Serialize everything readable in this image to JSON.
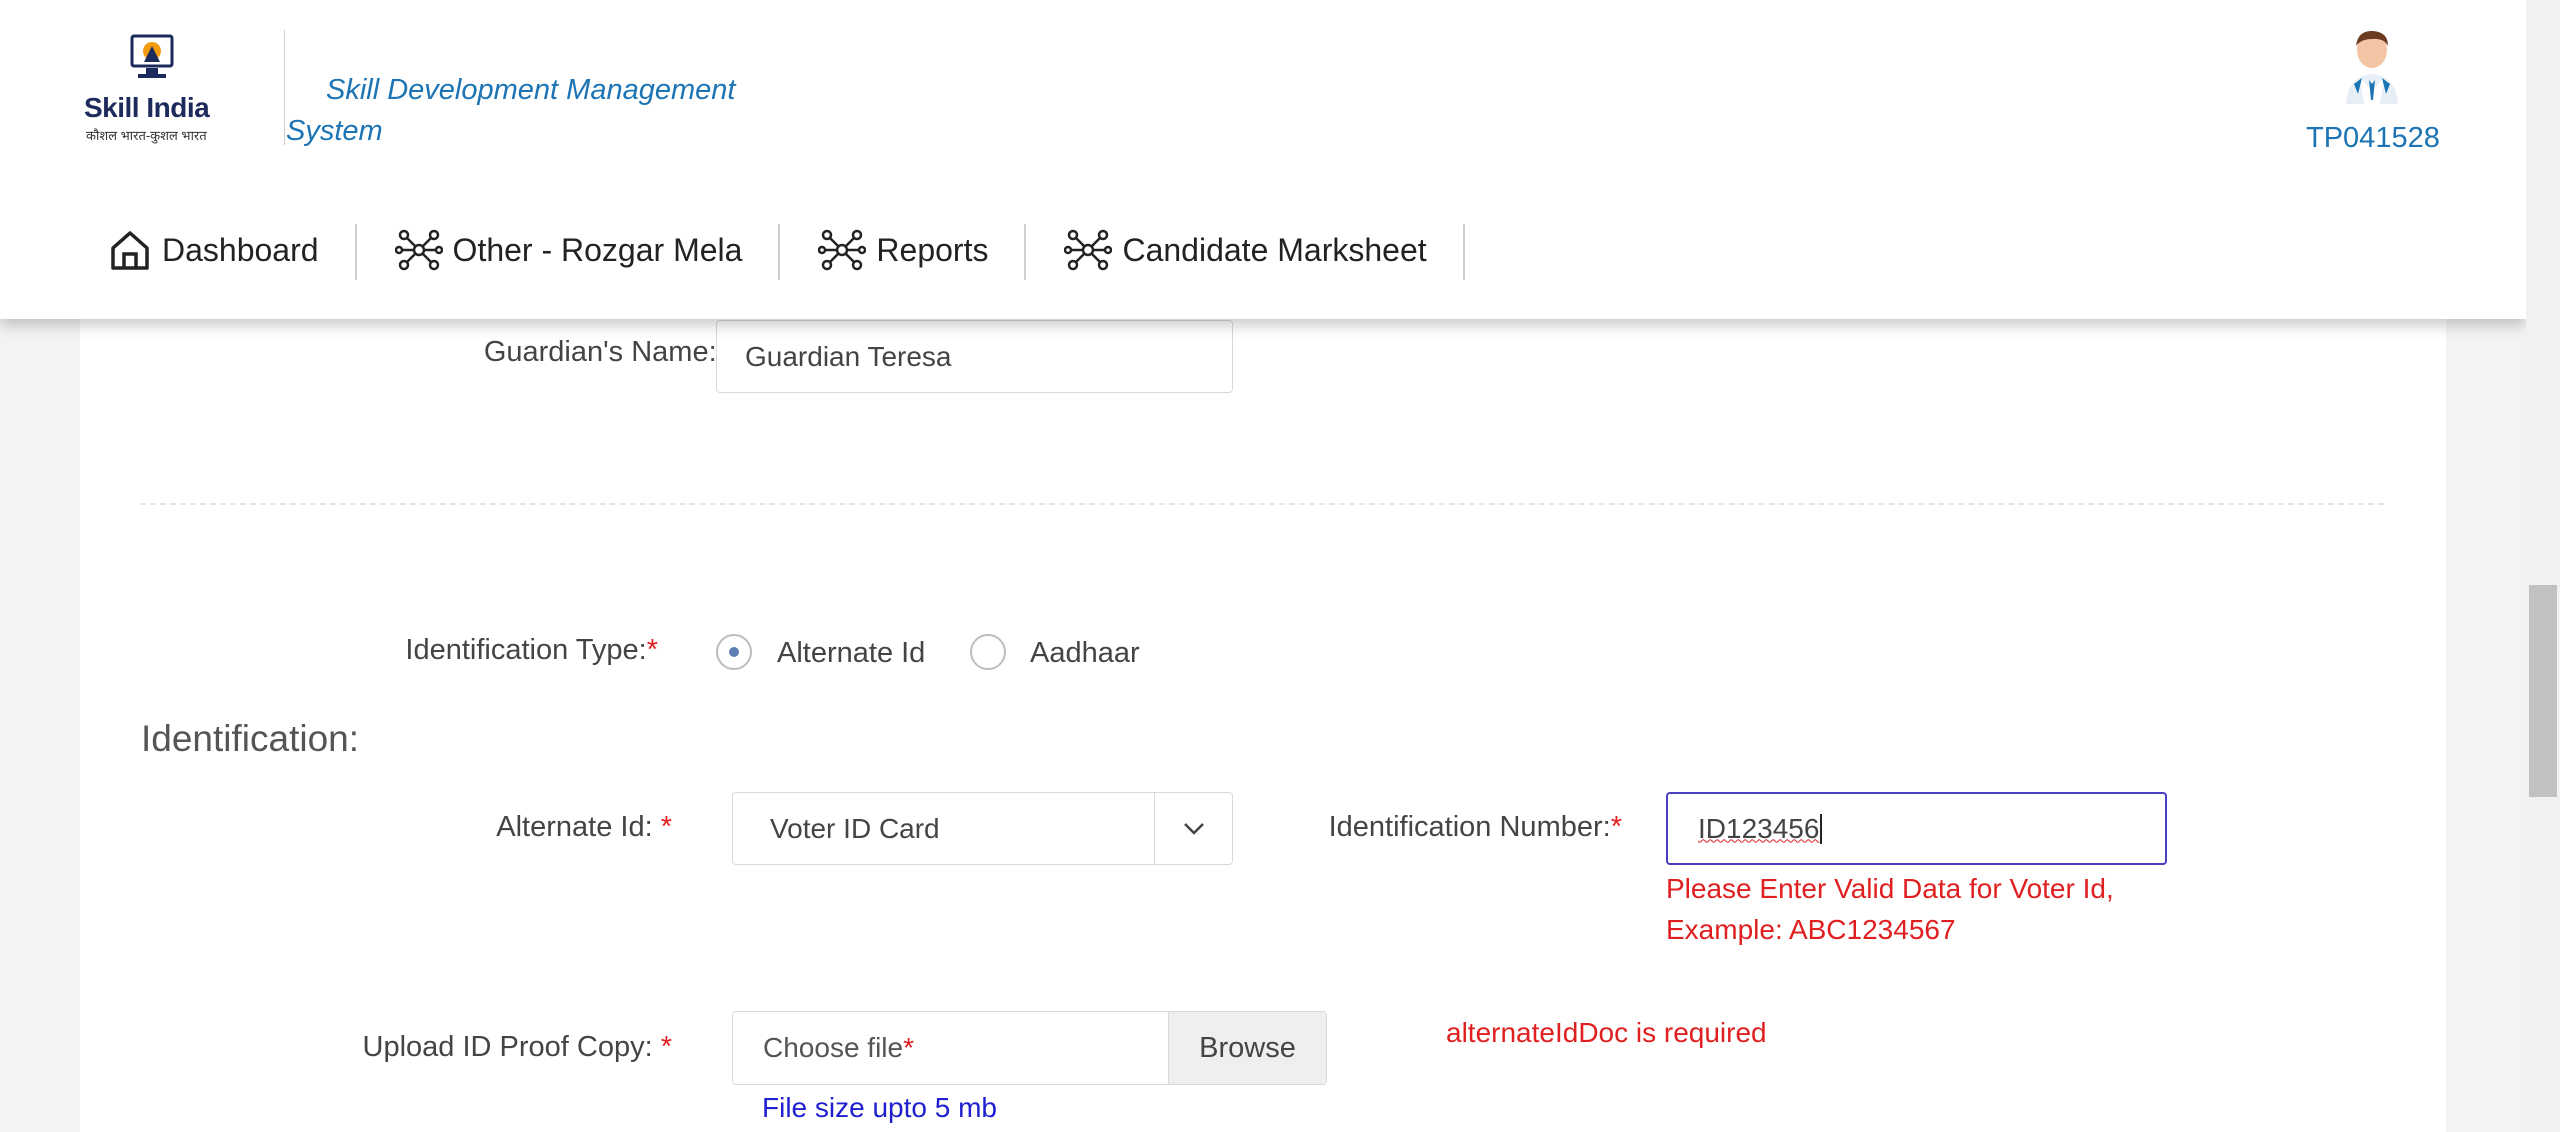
{
  "header": {
    "logo_text": "Skill India",
    "logo_tagline": "कौशल भारत-कुशल भारत",
    "app_title": "Skill Development Management System",
    "user_id": "TP041528"
  },
  "nav": [
    {
      "label": "Dashboard",
      "icon": "home-icon"
    },
    {
      "label": "Other - Rozgar Mela",
      "icon": "network-icon"
    },
    {
      "label": "Reports",
      "icon": "network-icon"
    },
    {
      "label": "Candidate Marksheet",
      "icon": "network-icon"
    }
  ],
  "form": {
    "guardian_label": "Guardian's Name: ",
    "guardian_value": "Guardian Teresa",
    "id_type_label": "Identification Type:",
    "id_type_options": [
      "Alternate Id",
      "Aadhaar"
    ],
    "id_type_selected": "Alternate Id",
    "section_title": "Identification:",
    "alt_id_label": "Alternate Id: ",
    "alt_id_value": "Voter ID Card",
    "id_number_label": "Identification Number:",
    "id_number_value": "ID123456",
    "id_number_error_line1": "Please Enter Valid Data for Voter Id,",
    "id_number_error_line2": "Example: ABC1234567",
    "upload_label": "Upload ID Proof Copy: ",
    "upload_placeholder": "Choose file",
    "browse_label": "Browse",
    "upload_error": "alternateIdDoc is required",
    "file_hint": "File size upto 5 mb",
    "required_mark": "*"
  },
  "colors": {
    "brand_blue": "#1c74b4",
    "error_red": "#e02020",
    "hint_blue": "#2020d0"
  }
}
